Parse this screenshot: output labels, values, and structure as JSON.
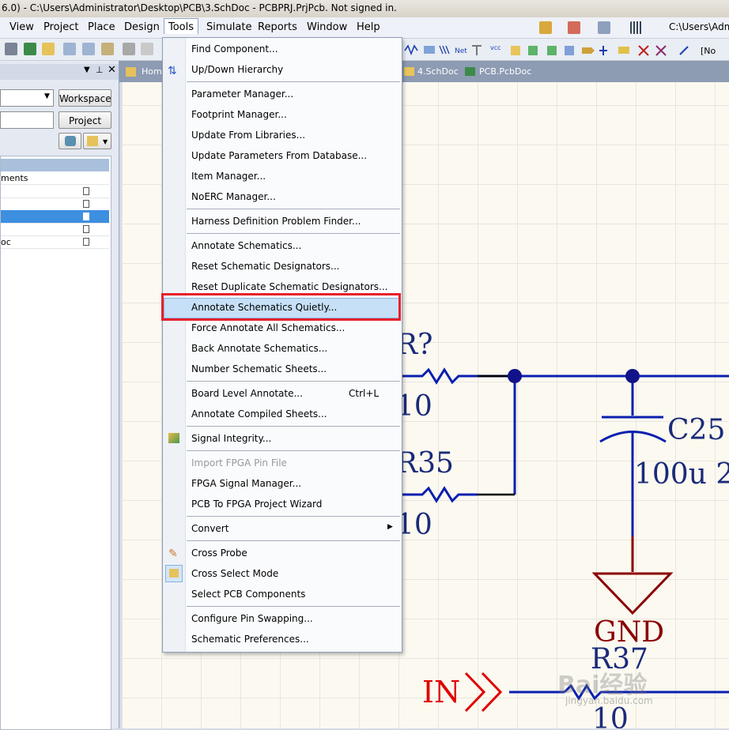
{
  "window": {
    "title": "6.0) - C:\\Users\\Administrator\\Desktop\\PCB\\3.SchDoc - PCBPRJ.PrjPcb. Not signed in.",
    "right_path": "C:\\Users\\Adm",
    "right_field": "[No"
  },
  "menubar": {
    "items": [
      "View",
      "Project",
      "Place",
      "Design",
      "Tools",
      "Simulate",
      "Reports",
      "Window",
      "Help"
    ]
  },
  "panel": {
    "workspace_button": "Workspace",
    "project_button": "Project",
    "tree_header_text": "ments",
    "tree_row_text": "oc"
  },
  "tabs": {
    "home": "Hom",
    "sheet4": "4.SchDoc",
    "pcb": "PCB.PcbDoc"
  },
  "tools_menu": {
    "items": [
      {
        "label": "Find Component..."
      },
      {
        "label": "Up/Down Hierarchy"
      },
      {
        "label": "Parameter Manager..."
      },
      {
        "label": "Footprint Manager..."
      },
      {
        "label": "Update From Libraries..."
      },
      {
        "label": "Update Parameters From Database..."
      },
      {
        "label": "Item Manager..."
      },
      {
        "label": "NoERC Manager..."
      },
      {
        "label": "Harness Definition Problem Finder..."
      },
      {
        "label": "Annotate Schematics..."
      },
      {
        "label": "Reset Schematic Designators..."
      },
      {
        "label": "Reset Duplicate Schematic Designators..."
      },
      {
        "label": "Annotate Schematics Quietly...",
        "highlighted": true
      },
      {
        "label": "Force Annotate All Schematics..."
      },
      {
        "label": "Back Annotate Schematics..."
      },
      {
        "label": "Number Schematic Sheets..."
      },
      {
        "label": "Board Level Annotate...",
        "shortcut": "Ctrl+L"
      },
      {
        "label": "Annotate Compiled Sheets..."
      },
      {
        "label": "Signal Integrity..."
      },
      {
        "label": "Import FPGA Pin File",
        "disabled": true
      },
      {
        "label": "FPGA Signal Manager..."
      },
      {
        "label": "PCB To FPGA Project Wizard"
      },
      {
        "label": "Convert",
        "submenu": true
      },
      {
        "label": "Cross Probe"
      },
      {
        "label": "Cross Select Mode"
      },
      {
        "label": "Select PCB Components"
      },
      {
        "label": "Configure Pin Swapping..."
      },
      {
        "label": "Schematic Preferences..."
      }
    ]
  },
  "schematic": {
    "r_unknown": "R?",
    "r_unknown_value": "10",
    "r35": "R35",
    "r35_value": "10",
    "c25": "C25",
    "c25_value": "100u 2",
    "gnd": "GND",
    "r37": "R37",
    "r37_value": "10",
    "in_port": "IN"
  },
  "watermark": {
    "text": "Bai经验",
    "sub": "jingyan.baidu.com"
  },
  "colors": {
    "wire": "#0a1fb0",
    "junction": "#12128a",
    "label": "#1a2a7a",
    "gnd": "#8b0000",
    "port": "#e00000",
    "highlight_box": "#e8202a"
  }
}
